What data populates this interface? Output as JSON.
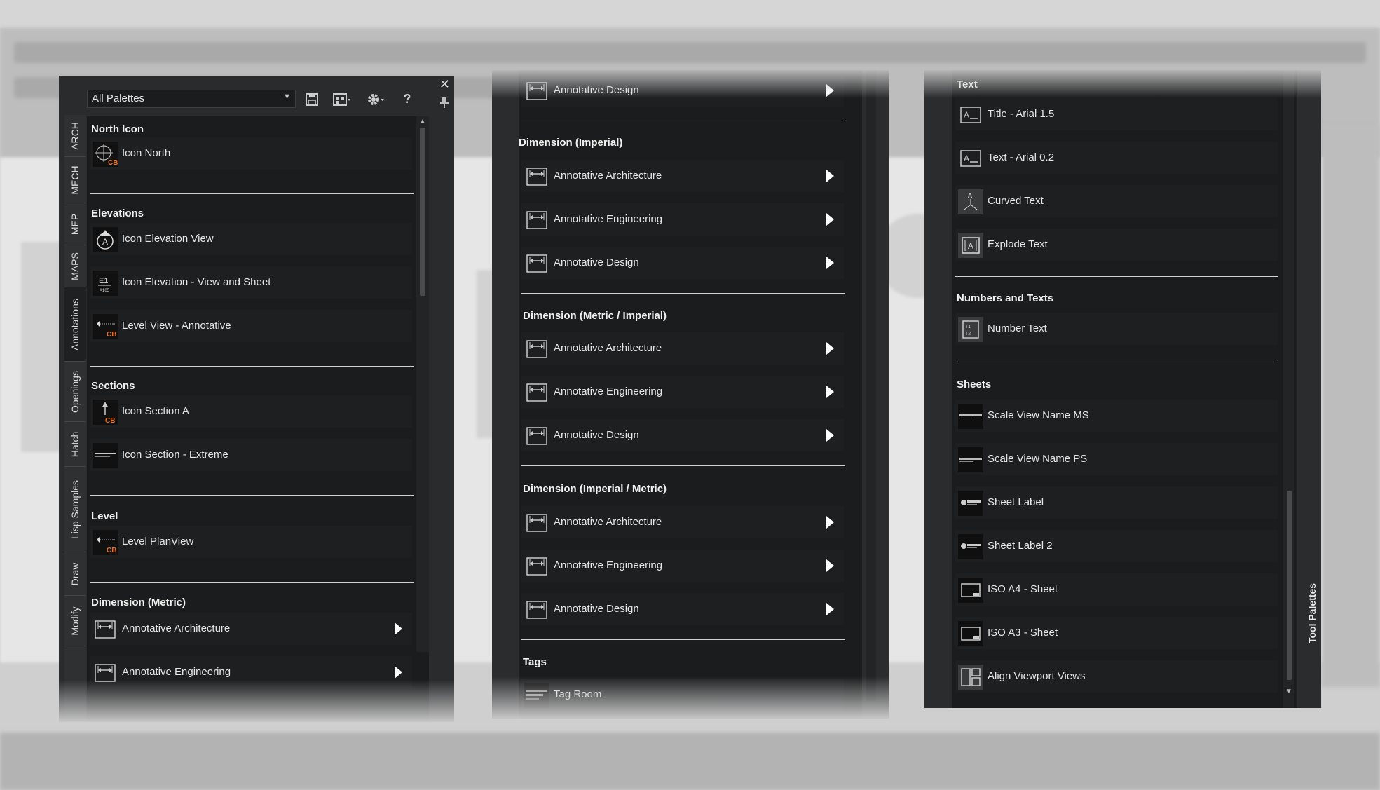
{
  "palette_selector": {
    "value": "All Palettes"
  },
  "toolbar": {
    "help_label": "?"
  },
  "close_glyph": "✕",
  "tabs": [
    "ARCH",
    "MECH",
    "MEP",
    "MAPS",
    "Annotations",
    "Openings",
    "Hatch",
    "Lisp Samples",
    "Draw",
    "Modify"
  ],
  "left": {
    "sections": [
      {
        "title": "North Icon",
        "items": [
          {
            "label": "Icon North",
            "icon": "north-arrow-icon"
          }
        ]
      },
      {
        "title": "Elevations",
        "items": [
          {
            "label": "Icon Elevation View",
            "icon": "elevation-marker-icon"
          },
          {
            "label": "Icon Elevation - View and Sheet",
            "icon": "elevation-tag-icon"
          },
          {
            "label": "Level View - Annotative",
            "icon": "level-icon"
          }
        ]
      },
      {
        "title": "Sections",
        "items": [
          {
            "label": "Icon Section A",
            "icon": "section-icon"
          },
          {
            "label": "Icon Section - Extreme",
            "icon": "section-extreme-icon"
          }
        ]
      },
      {
        "title": "Level",
        "items": [
          {
            "label": "Level PlanView",
            "icon": "level-icon"
          }
        ]
      },
      {
        "title": "Dimension (Metric)",
        "items": [
          {
            "label": "Annotative Architecture",
            "icon": "dimension-icon"
          },
          {
            "label": "Annotative Engineering",
            "icon": "dimension-icon"
          }
        ]
      }
    ]
  },
  "middle": {
    "top_item": "Annotative Design",
    "sections": [
      {
        "title": "Dimension (Imperial)",
        "items": [
          "Annotative Architecture",
          "Annotative Engineering",
          "Annotative Design"
        ]
      },
      {
        "title": "Dimension (Metric / Imperial)",
        "items": [
          "Annotative Architecture",
          "Annotative Engineering",
          "Annotative Design"
        ]
      },
      {
        "title": "Dimension (Imperial / Metric)",
        "items": [
          "Annotative Architecture",
          "Annotative Engineering",
          "Annotative Design"
        ]
      },
      {
        "title": "Tags",
        "items": [
          "Tag Room"
        ]
      }
    ]
  },
  "right": {
    "sections": [
      {
        "title": "Text",
        "items": [
          {
            "label": "Title - Arial 1.5",
            "icon": "text-style-icon"
          },
          {
            "label": "Text - Arial 0.2",
            "icon": "text-style-icon"
          },
          {
            "label": "Curved Text",
            "icon": "curved-text-icon"
          },
          {
            "label": "Explode Text",
            "icon": "explode-text-icon"
          }
        ]
      },
      {
        "title": "Numbers and Texts",
        "items": [
          {
            "label": "Number Text",
            "icon": "number-text-icon"
          }
        ]
      },
      {
        "title": "Sheets",
        "items": [
          {
            "label": "Scale View Name MS",
            "icon": "scale-view-icon"
          },
          {
            "label": "Scale View Name PS",
            "icon": "scale-view-icon"
          },
          {
            "label": "Sheet Label",
            "icon": "sheet-label-icon"
          },
          {
            "label": "Sheet Label 2",
            "icon": "sheet-label-icon"
          },
          {
            "label": "ISO A4 - Sheet",
            "icon": "sheet-frame-icon"
          },
          {
            "label": "ISO A3 - Sheet",
            "icon": "sheet-frame-icon"
          },
          {
            "label": "Align Viewport Views",
            "icon": "align-viewports-icon"
          }
        ]
      }
    ],
    "side_title": "Tool Palettes"
  },
  "colors": {
    "accent_orange": "#e8702a",
    "panel_bg": "#1b1c1d",
    "text": "#e6e6e6"
  }
}
